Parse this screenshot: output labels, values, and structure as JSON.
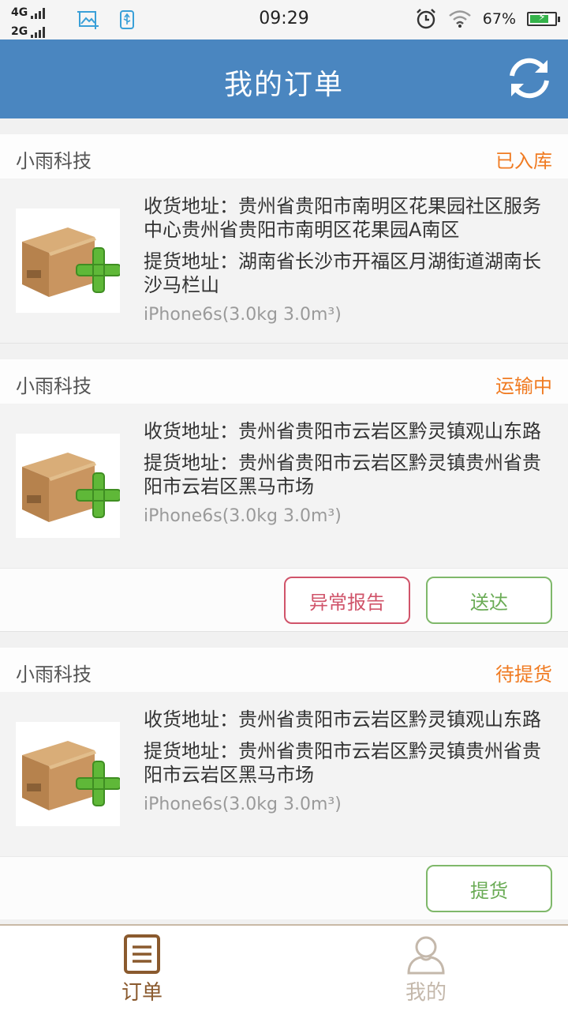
{
  "status_bar": {
    "network_1": "4G",
    "network_2": "2G",
    "time": "09:29",
    "battery": "67%"
  },
  "header": {
    "title": "我的订单",
    "refresh_icon": "refresh-icon"
  },
  "orders": [
    {
      "company": "小雨科技",
      "status": "已入库",
      "receive_address": "收货地址：贵州省贵阳市南明区花果园社区服务中心贵州省贵阳市南明区花果园A南区",
      "pickup_address": "提货地址：湖南省长沙市开福区月湖街道湖南长沙马栏山",
      "goods": "iPhone6s(3.0kg  3.0m³)"
    },
    {
      "company": "小雨科技",
      "status": "运输中",
      "receive_address": "收货地址：贵州省贵阳市云岩区黔灵镇观山东路",
      "pickup_address": "提货地址：贵州省贵阳市云岩区黔灵镇贵州省贵阳市云岩区黑马市场",
      "goods": "iPhone6s(3.0kg  3.0m³)",
      "btn_exception": "异常报告",
      "btn_deliver": "送达"
    },
    {
      "company": "小雨科技",
      "status": "待提货",
      "receive_address": "收货地址：贵州省贵阳市云岩区黔灵镇观山东路",
      "pickup_address": "提货地址：贵州省贵阳市云岩区黔灵镇贵州省贵阳市云岩区黑马市场",
      "goods": "iPhone6s(3.0kg  3.0m³)",
      "btn_pickup": "提货"
    }
  ],
  "tabbar": {
    "orders_label": "订单",
    "mine_label": "我的"
  },
  "colors": {
    "header": "#4a86c0",
    "status": "#f07b22",
    "danger": "#d0546a",
    "success": "#6aab55",
    "tab_active": "#8a5a2e"
  }
}
